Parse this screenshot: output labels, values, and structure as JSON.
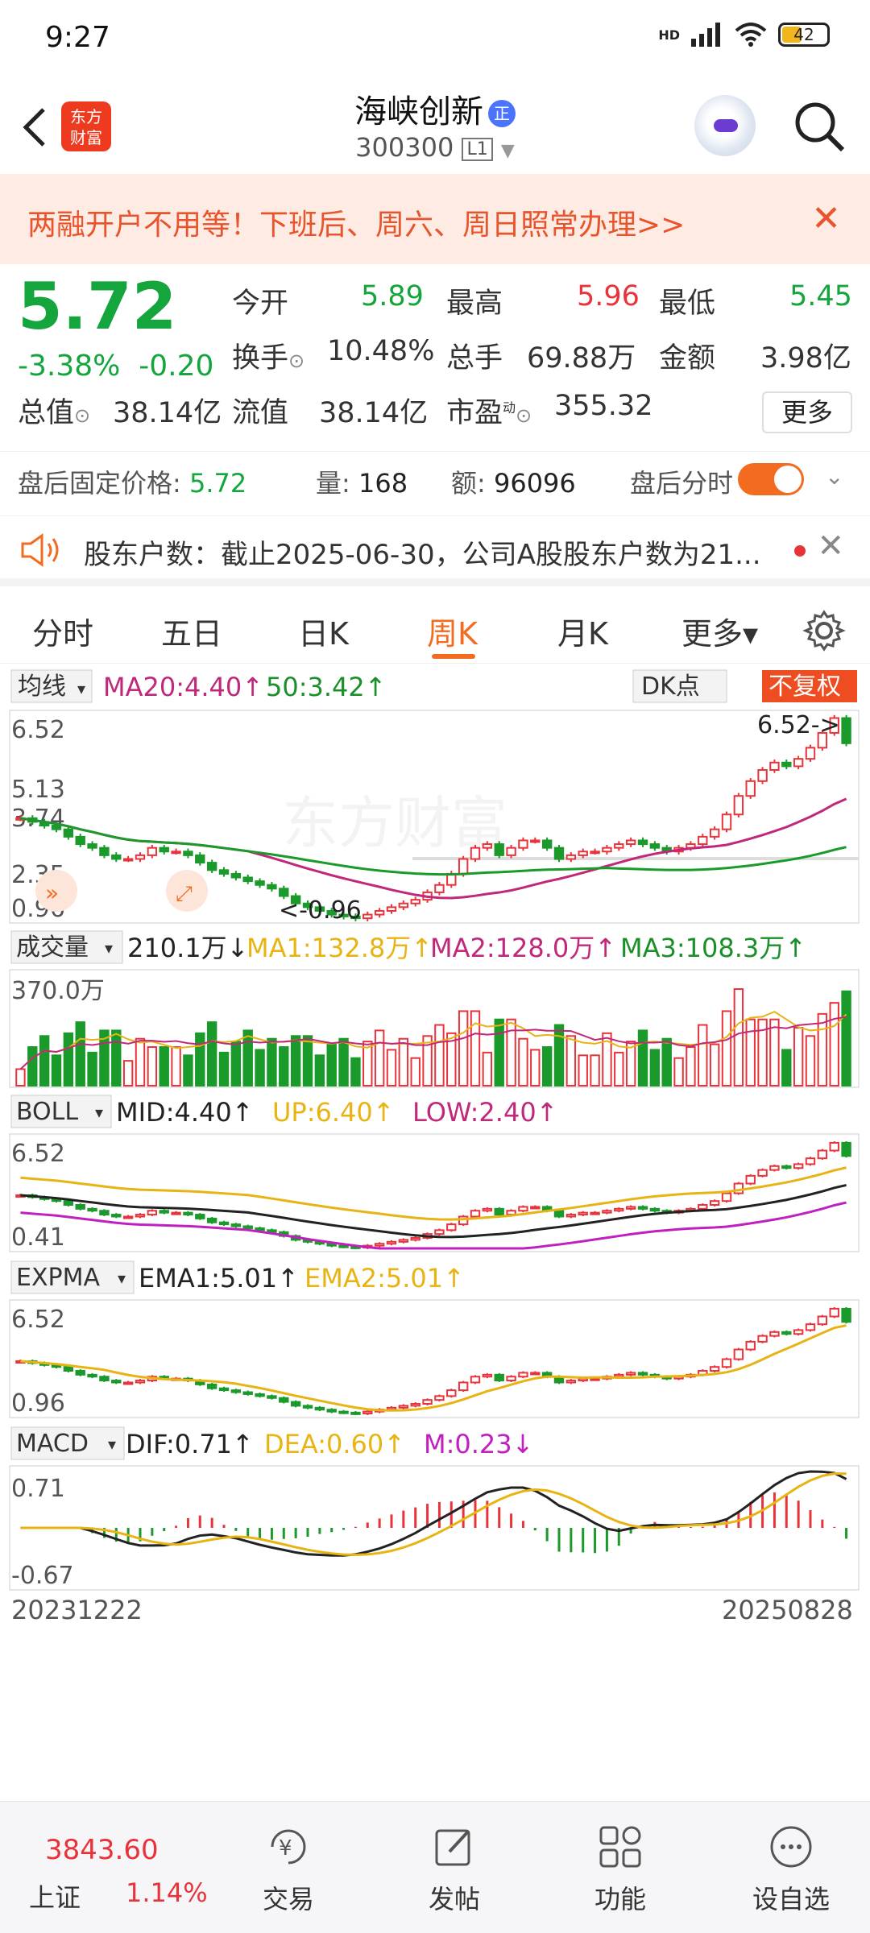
{
  "status": {
    "time": "9:27",
    "net": "HD",
    "battery": "42",
    "battery_level": 0.42
  },
  "header": {
    "logo": "东方\n财富",
    "name": "海峡创新",
    "badge": "正",
    "code": "300300",
    "level": "L1"
  },
  "banner": {
    "text": "两融开户不用等！下班后、周六、周日照常办理>>"
  },
  "quote": {
    "price": "5.72",
    "change_pct": "-3.38%",
    "change": "-0.20",
    "open_label": "今开",
    "open": "5.89",
    "high_label": "最高",
    "high": "5.96",
    "low_label": "最低",
    "low": "5.45",
    "turnover_label": "换手",
    "turnover": "10.48%",
    "vol_label": "总手",
    "vol": "69.88万",
    "amount_label": "金额",
    "amount": "3.98亿",
    "mcap_label": "总值",
    "mcap": "38.14亿",
    "float_label": "流值",
    "float": "38.14亿",
    "pe_label": "市盈",
    "pe_sup": "动",
    "pe": "355.32",
    "more": "更多"
  },
  "after": {
    "fixed_label": "盘后固定价格:",
    "fixed": "5.72",
    "qty_label": "量:",
    "qty": "168",
    "amt_label": "额:",
    "amt": "96096",
    "tl_label": "盘后分时"
  },
  "notice": {
    "text": "股东户数：截止2025-06-30，公司A股股东户数为21..."
  },
  "tabs": [
    "分时",
    "五日",
    "日K",
    "周K",
    "月K",
    "更多▾"
  ],
  "chart": {
    "ma": {
      "sel": "均线",
      "ma20": "MA20:4.40↑",
      "ma50": "50:3.42↑",
      "dk": "DK点",
      "fq": "不复权",
      "y": [
        "6.52",
        "5.13",
        "3.74",
        "2.35",
        "0.96"
      ],
      "hi": "6.52->",
      "lo": "<-0.96",
      "wm": "东方财富"
    },
    "vol": {
      "sel": "成交量",
      "v": "210.1万↓",
      "ma1": "MA1:132.8万↑",
      "ma2": "MA2:128.0万↑",
      "ma3": "MA3:108.3万↑",
      "y": "370.0万"
    },
    "boll": {
      "sel": "BOLL",
      "mid": "MID:4.40↑",
      "up": "UP:6.40↑",
      "low": "LOW:2.40↑",
      "y1": "6.52",
      "y2": "0.41"
    },
    "expma": {
      "sel": "EXPMA",
      "e1": "EMA1:5.01↑",
      "e2": "EMA2:5.01↑",
      "y1": "6.52",
      "y2": "0.96"
    },
    "macd": {
      "sel": "MACD",
      "dif": "DIF:0.71↑",
      "dea": "DEA:0.60↑",
      "m": "M:0.23↓",
      "y1": "0.71",
      "y2": "-0.67"
    },
    "dates": [
      "20231222",
      "20250828"
    ]
  },
  "chart_data": {
    "type": "candlestick",
    "x_range": [
      "20231222",
      "20250828"
    ],
    "ylim": [
      0.96,
      6.52
    ],
    "close": [
      3.7,
      3.6,
      3.5,
      3.4,
      3.2,
      3.0,
      2.9,
      2.7,
      2.6,
      2.6,
      2.7,
      2.9,
      2.8,
      2.8,
      2.7,
      2.5,
      2.3,
      2.2,
      2.1,
      2.0,
      1.9,
      1.8,
      1.6,
      1.4,
      1.3,
      1.2,
      1.1,
      1.05,
      1.0,
      1.1,
      1.2,
      1.3,
      1.4,
      1.5,
      1.7,
      1.9,
      2.2,
      2.6,
      2.9,
      3.0,
      2.7,
      2.9,
      3.1,
      3.1,
      2.9,
      2.6,
      2.7,
      2.8,
      2.8,
      2.9,
      3.0,
      3.1,
      3.0,
      2.9,
      2.8,
      2.9,
      3.0,
      3.2,
      3.4,
      3.8,
      4.3,
      4.7,
      5.0,
      5.2,
      5.1,
      5.3,
      5.6,
      6.0,
      6.4,
      5.72
    ]
  },
  "bottom": {
    "index_val": "3843.60",
    "index_name": "上证",
    "index_pct": "1.14%",
    "trade": "交易",
    "post": "发帖",
    "func": "功能",
    "watch": "设自选"
  }
}
